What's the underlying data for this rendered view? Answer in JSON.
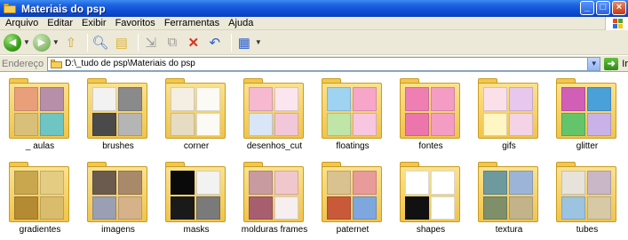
{
  "window": {
    "title": "Materiais do psp",
    "minimize": "_",
    "maximize": "□",
    "close": "×"
  },
  "menu": [
    "Arquivo",
    "Editar",
    "Exibir",
    "Favoritos",
    "Ferramentas",
    "Ajuda"
  ],
  "toolbar": {
    "back_icon": "back-arrow-icon",
    "forward_icon": "forward-arrow-icon",
    "up_icon": "folder-up-icon",
    "search_icon": "search-icon",
    "folders_icon": "folders-icon",
    "move_to_icon": "move-to-icon",
    "copy_to_icon": "copy-to-icon",
    "delete_icon": "delete-icon",
    "undo_icon": "undo-icon",
    "views_icon": "views-icon"
  },
  "address": {
    "label": "Endereço",
    "value": "D:\\_tudo de psp\\Materiais do psp",
    "go_label": "Ir"
  },
  "folders": [
    {
      "name": "_ aulas",
      "colors": [
        "#e9a07a",
        "#b78fa8",
        "#d8c07a",
        "#6fc4c4"
      ]
    },
    {
      "name": "brushes",
      "colors": [
        "#f2f2f2",
        "#8a8a8a",
        "#4a4a4a",
        "#b5b5b5"
      ]
    },
    {
      "name": "corner",
      "colors": [
        "#f4efe2",
        "#fbfaf5",
        "#e6dcc4",
        "#fbfaf5"
      ]
    },
    {
      "name": "desenhos_cut",
      "colors": [
        "#f6b9d0",
        "#fbe6ef",
        "#d9e6f7",
        "#f3c7da"
      ]
    },
    {
      "name": "floatings",
      "colors": [
        "#9fd3f2",
        "#f7a6c9",
        "#bfe6a8",
        "#f8c6e0"
      ]
    },
    {
      "name": "fontes",
      "colors": [
        "#ef7fb2",
        "#f59cc4",
        "#ec75ab",
        "#f59cc4"
      ]
    },
    {
      "name": "gifs",
      "colors": [
        "#fbe0ea",
        "#e7c7ee",
        "#fff6c4",
        "#f4d3e6"
      ]
    },
    {
      "name": "glitter",
      "colors": [
        "#d25fb6",
        "#4aa0d8",
        "#64c46a",
        "#c8b2e8"
      ]
    },
    {
      "name": "gradientes",
      "colors": [
        "#c9a74e",
        "#e5cc83",
        "#b48a33",
        "#d9bd6c"
      ]
    },
    {
      "name": "imagens",
      "colors": [
        "#6b5b4f",
        "#a88a6a",
        "#9a9fb3",
        "#d6b28a"
      ]
    },
    {
      "name": "masks",
      "colors": [
        "#0a0a0a",
        "#f2f2f2",
        "#1a1a1a",
        "#7a7a7a"
      ]
    },
    {
      "name": "molduras frames",
      "colors": [
        "#c79b9f",
        "#f0c7cc",
        "#a75f6f",
        "#f7eef0"
      ]
    },
    {
      "name": "paternet",
      "colors": [
        "#d9c28f",
        "#e99a9a",
        "#c85a3a",
        "#7ea6df"
      ]
    },
    {
      "name": "shapes",
      "colors": [
        "#ffffff",
        "#ffffff",
        "#111111",
        "#ffffff"
      ]
    },
    {
      "name": "textura",
      "colors": [
        "#6e9a9e",
        "#9bb4d8",
        "#7f8f6a",
        "#c2b38a"
      ]
    },
    {
      "name": "tubes",
      "colors": [
        "#e8e3da",
        "#c9b6c7",
        "#9cc3e0",
        "#d7c9a6"
      ]
    }
  ]
}
